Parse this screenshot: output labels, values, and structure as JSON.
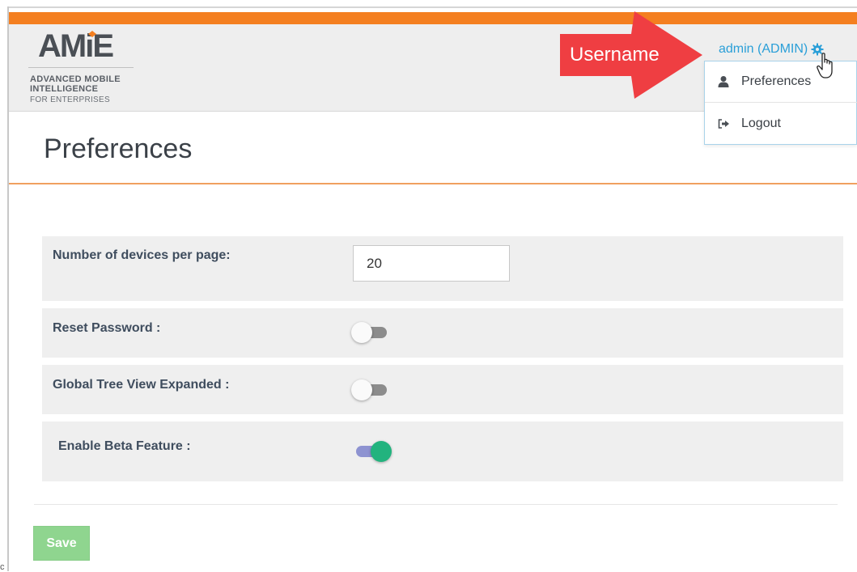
{
  "header": {
    "logo": {
      "wordmark": "AMiE",
      "line1": "ADVANCED MOBILE",
      "line2": "INTELLIGENCE",
      "line3": "FOR ENTERPRISES"
    },
    "user_label": "admin (ADMIN)",
    "user_icon": "gear-icon",
    "annotation_label": "Username",
    "user_dropdown": [
      {
        "label": "Preferences",
        "icon": "user-icon"
      },
      {
        "label": "Logout",
        "icon": "logout-icon"
      }
    ]
  },
  "page": {
    "title": "Preferences"
  },
  "settings": [
    {
      "label": "Number of devices per page:",
      "type": "number",
      "value": "20"
    },
    {
      "label": "Reset Password :",
      "type": "toggle",
      "enabled": false
    },
    {
      "label": "Global Tree View Expanded :",
      "type": "toggle",
      "enabled": false
    },
    {
      "label": "Enable Beta Feature :",
      "type": "toggle",
      "enabled": true
    }
  ],
  "actions": {
    "save_label": "Save"
  },
  "corner_text": "c",
  "colors": {
    "accent_orange": "#f47f20",
    "link_blue": "#2a9fd8",
    "callout_red": "#ef3e42",
    "toggle_on": "#22b37e",
    "save_green": "#8fd58f"
  }
}
